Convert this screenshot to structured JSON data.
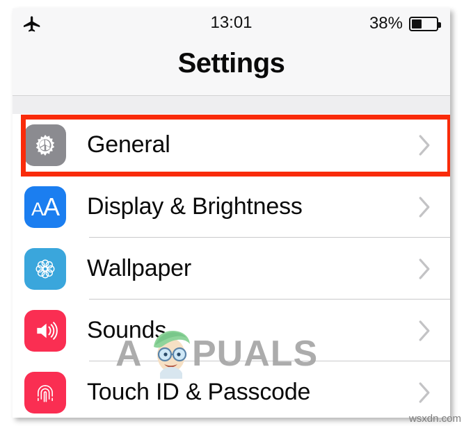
{
  "status_bar": {
    "airplane_icon": "airplane-mode-icon",
    "time": "13:01",
    "battery_percent_label": "38%",
    "battery_level": 38,
    "battery_icon": "battery-icon"
  },
  "nav_bar": {
    "title": "Settings"
  },
  "settings_list": {
    "rows": [
      {
        "label": "General",
        "icon": "gear-icon",
        "icon_color": "#8b8b90",
        "chevron": "chevron-right-icon",
        "highlighted": true
      },
      {
        "label": "Display & Brightness",
        "icon": "text-size-aa-icon",
        "icon_color": "#1b7ef0",
        "chevron": "chevron-right-icon",
        "highlighted": false
      },
      {
        "label": "Wallpaper",
        "icon": "flower-rosette-icon",
        "icon_color": "#3aa6dc",
        "chevron": "chevron-right-icon",
        "highlighted": false
      },
      {
        "label": "Sounds",
        "icon": "speaker-volume-icon",
        "icon_color": "#fa2e52",
        "chevron": "chevron-right-icon",
        "highlighted": false
      },
      {
        "label": "Touch ID & Passcode",
        "icon": "fingerprint-icon",
        "icon_color": "#fa2e52",
        "chevron": "chevron-right-icon",
        "highlighted": false
      }
    ]
  },
  "annotation": {
    "highlight_color": "#f92b0a",
    "target_row": "General"
  },
  "watermarks": {
    "brand_text": "PUALS",
    "brand_prefix": "A",
    "brand_color": "#a6a6a6",
    "site": "wsxdn.com"
  }
}
